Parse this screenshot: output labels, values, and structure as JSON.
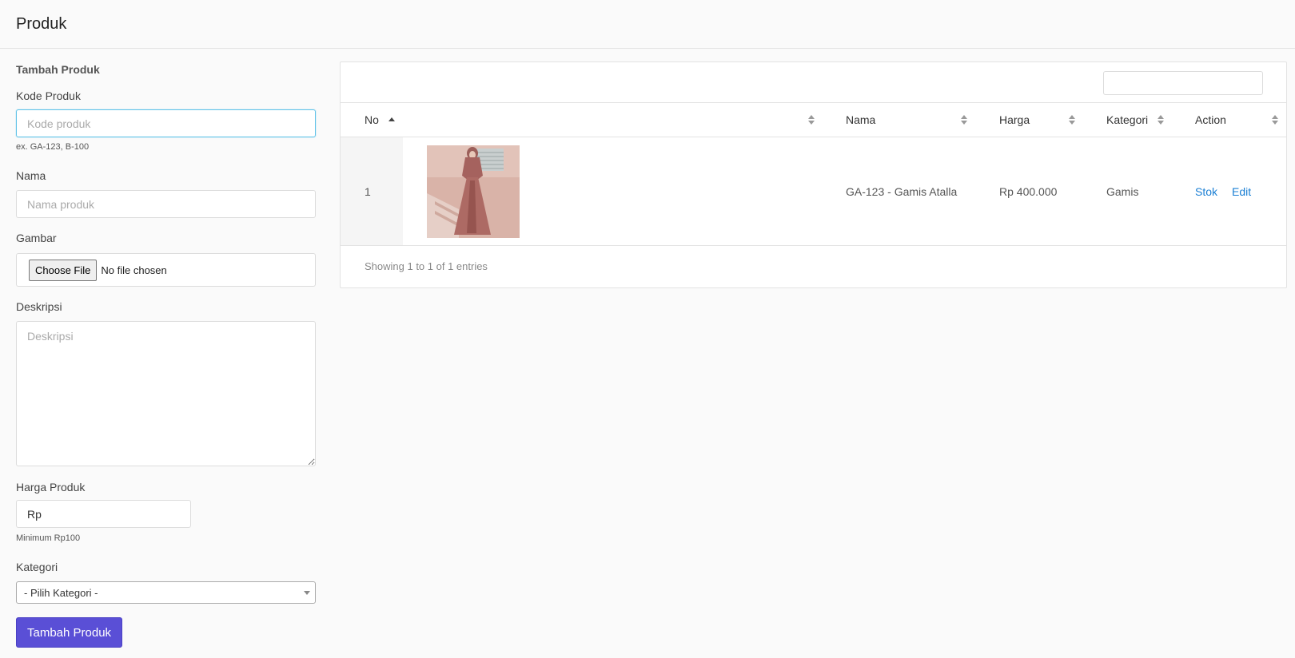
{
  "header": {
    "title": "Produk"
  },
  "form": {
    "section_title": "Tambah Produk",
    "kode": {
      "label": "Kode Produk",
      "placeholder": "Kode produk",
      "help": "ex. GA-123, B-100"
    },
    "nama": {
      "label": "Nama",
      "placeholder": "Nama produk"
    },
    "gambar": {
      "label": "Gambar",
      "button": "Choose File",
      "status": "No file chosen"
    },
    "deskripsi": {
      "label": "Deskripsi",
      "placeholder": "Deskripsi"
    },
    "harga": {
      "label": "Harga Produk",
      "value": "Rp",
      "help": "Minimum Rp100"
    },
    "kategori": {
      "label": "Kategori",
      "selected": "- Pilih Kategori -"
    },
    "submit": "Tambah Produk"
  },
  "table": {
    "columns": [
      "No",
      "Nama",
      "Harga",
      "Kategori",
      "Action"
    ],
    "rows": [
      {
        "no": "1",
        "nama": "GA-123 - Gamis Atalla",
        "harga": "Rp 400.000",
        "kategori": "Gamis",
        "actions": [
          "Stok",
          "Edit"
        ]
      }
    ],
    "info": "Showing 1 to 1 of 1 entries"
  },
  "colors": {
    "primary": "#5a4fd6",
    "link": "#1a7fd4",
    "focus": "#61c3e8"
  }
}
